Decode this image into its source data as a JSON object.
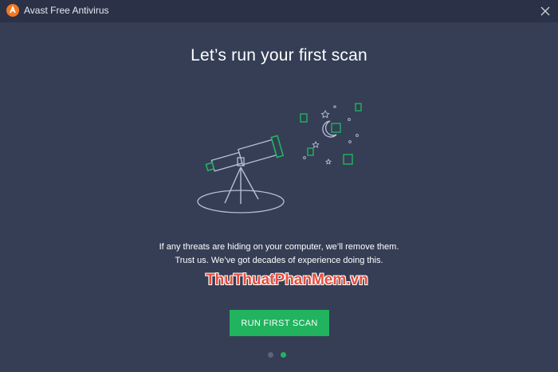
{
  "window": {
    "title": "Avast Free Antivirus",
    "logo_icon": "avast-logo-icon",
    "close_icon": "close-icon"
  },
  "main": {
    "headline": "Let’s run your first scan",
    "description_line1": "If any threats are hiding on your computer, we’ll remove them.",
    "description_line2": "Trust us. We’ve got decades of experience doing this.",
    "watermark": "ThuThuatPhanMem.vn",
    "primary_button": "RUN FIRST SCAN"
  },
  "pager": {
    "total": 2,
    "active_index": 1
  },
  "colors": {
    "background": "#353e55",
    "titlebar": "#2b3247",
    "accent_green": "#21b35e",
    "logo_orange": "#f47920"
  }
}
